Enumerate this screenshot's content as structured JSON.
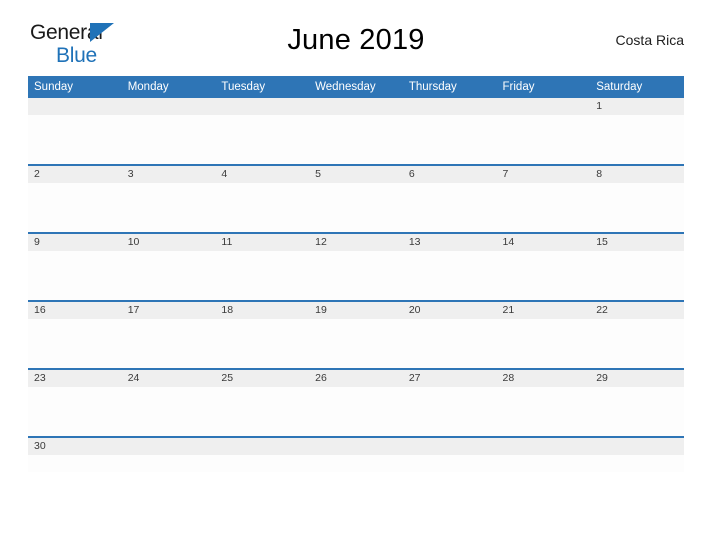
{
  "header": {
    "logo": {
      "word_1": "General",
      "word_2": "Blue",
      "flag_icon": "triangle-flag-icon"
    },
    "title": "June 2019",
    "region": "Costa Rica"
  },
  "calendar": {
    "month": "June",
    "year": "2019",
    "weekday_headers": [
      "Sunday",
      "Monday",
      "Tuesday",
      "Wednesday",
      "Thursday",
      "Friday",
      "Saturday"
    ],
    "weeks": [
      {
        "days": [
          {
            "number": ""
          },
          {
            "number": ""
          },
          {
            "number": ""
          },
          {
            "number": ""
          },
          {
            "number": ""
          },
          {
            "number": ""
          },
          {
            "number": "1"
          }
        ]
      },
      {
        "days": [
          {
            "number": "2"
          },
          {
            "number": "3"
          },
          {
            "number": "4"
          },
          {
            "number": "5"
          },
          {
            "number": "6"
          },
          {
            "number": "7"
          },
          {
            "number": "8"
          }
        ]
      },
      {
        "days": [
          {
            "number": "9"
          },
          {
            "number": "10"
          },
          {
            "number": "11"
          },
          {
            "number": "12"
          },
          {
            "number": "13"
          },
          {
            "number": "14"
          },
          {
            "number": "15"
          }
        ]
      },
      {
        "days": [
          {
            "number": "16"
          },
          {
            "number": "17"
          },
          {
            "number": "18"
          },
          {
            "number": "19"
          },
          {
            "number": "20"
          },
          {
            "number": "21"
          },
          {
            "number": "22"
          }
        ]
      },
      {
        "days": [
          {
            "number": "23"
          },
          {
            "number": "24"
          },
          {
            "number": "25"
          },
          {
            "number": "26"
          },
          {
            "number": "27"
          },
          {
            "number": "28"
          },
          {
            "number": "29"
          }
        ]
      },
      {
        "days": [
          {
            "number": "30"
          },
          {
            "number": ""
          },
          {
            "number": ""
          },
          {
            "number": ""
          },
          {
            "number": ""
          },
          {
            "number": ""
          },
          {
            "number": ""
          }
        ]
      }
    ]
  },
  "colors": {
    "brand_blue": "#2e75b6",
    "logo_blue": "#1f72b8",
    "daynum_band": "#efefef",
    "page_background": "#ffffff",
    "header_text": "#ffffff"
  }
}
